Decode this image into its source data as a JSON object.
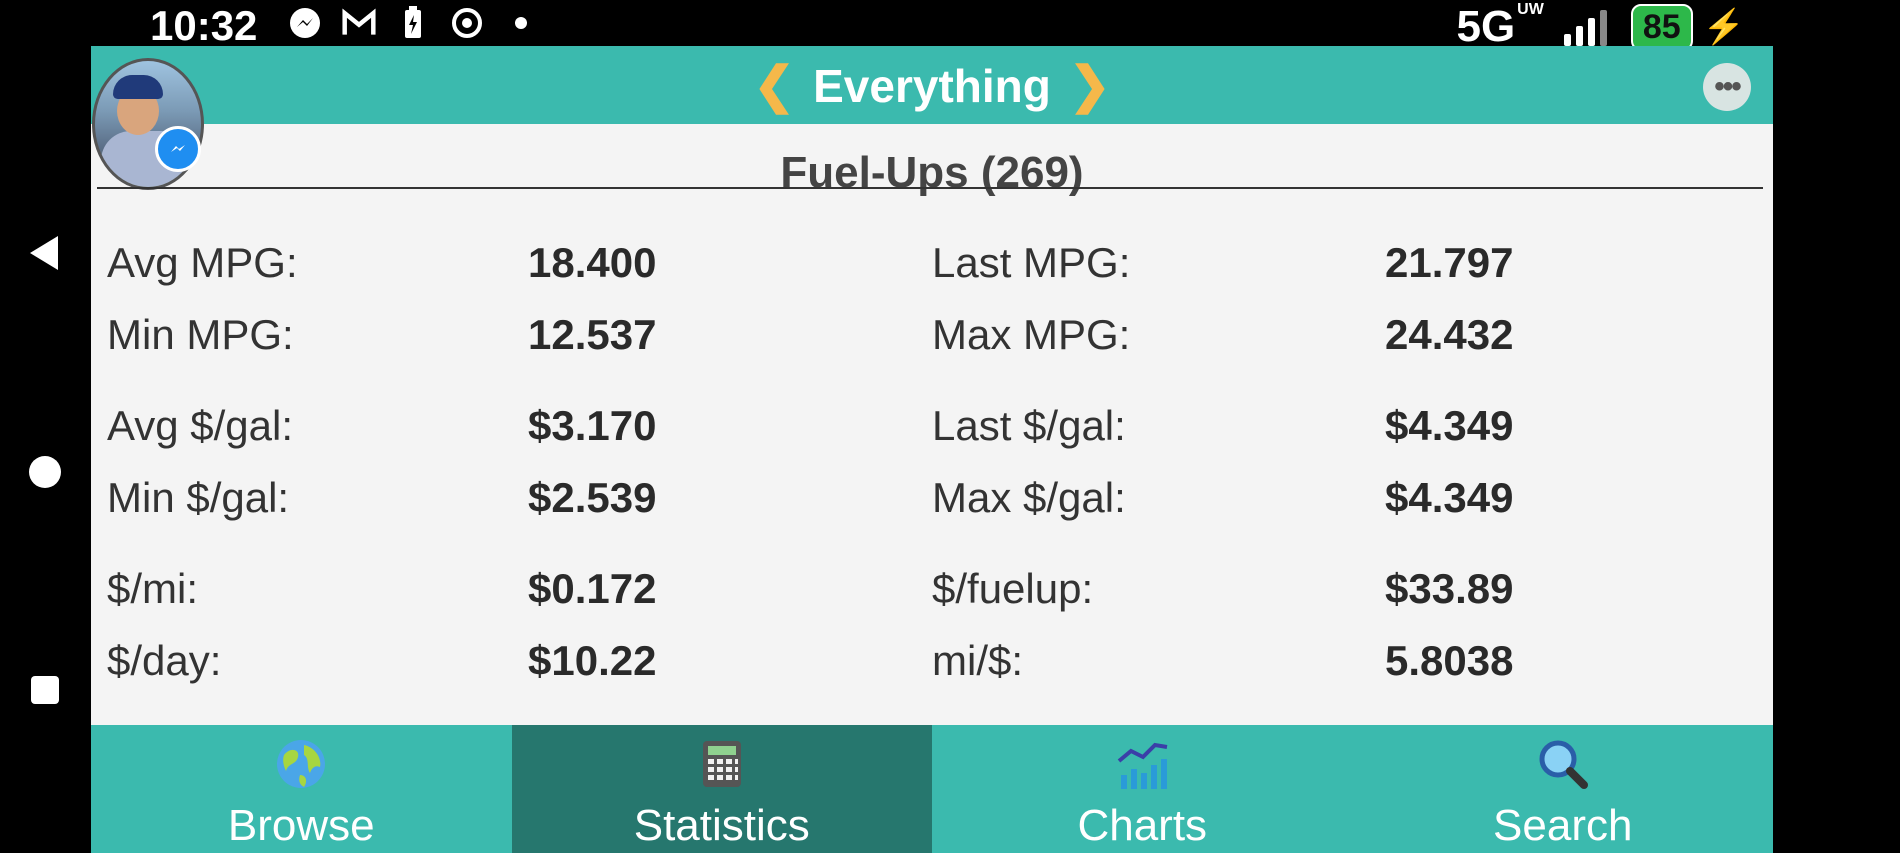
{
  "status_bar": {
    "time": "10:32",
    "icons": [
      "messenger-icon",
      "gmail-icon",
      "battery-saver-icon",
      "chrome-icon",
      "dot-icon"
    ],
    "network": "5G",
    "network_badge": "UW",
    "battery": "85"
  },
  "header": {
    "prev_label": "❮",
    "title": "Everything",
    "next_label": "❯",
    "more_label": "•••"
  },
  "section": {
    "title": "Fuel-Ups (269)"
  },
  "stats": {
    "left": [
      {
        "label": "Avg MPG:",
        "value": "18.400"
      },
      {
        "label": "Min MPG:",
        "value": "12.537"
      },
      {
        "label": "Avg $/gal:",
        "value": "$3.170"
      },
      {
        "label": "Min $/gal:",
        "value": "$2.539"
      },
      {
        "label": "$/mi:",
        "value": "$0.172"
      },
      {
        "label": "$/day:",
        "value": "$10.22"
      }
    ],
    "right": [
      {
        "label": "Last MPG:",
        "value": "21.797"
      },
      {
        "label": "Max MPG:",
        "value": "24.432"
      },
      {
        "label": "Last $/gal:",
        "value": "$4.349"
      },
      {
        "label": "Max $/gal:",
        "value": "$4.349"
      },
      {
        "label": "$/fuelup:",
        "value": "$33.89"
      },
      {
        "label": "mi/$:",
        "value": "5.8038"
      }
    ]
  },
  "tabs": [
    {
      "label": "Browse",
      "icon": "globe-icon"
    },
    {
      "label": "Statistics",
      "icon": "calculator-icon",
      "active": true
    },
    {
      "label": "Charts",
      "icon": "chart-icon"
    },
    {
      "label": "Search",
      "icon": "magnifier-icon"
    }
  ],
  "colors": {
    "header": "#3bbaae",
    "active_tab": "#26776e",
    "chevron": "#f5b84a"
  }
}
